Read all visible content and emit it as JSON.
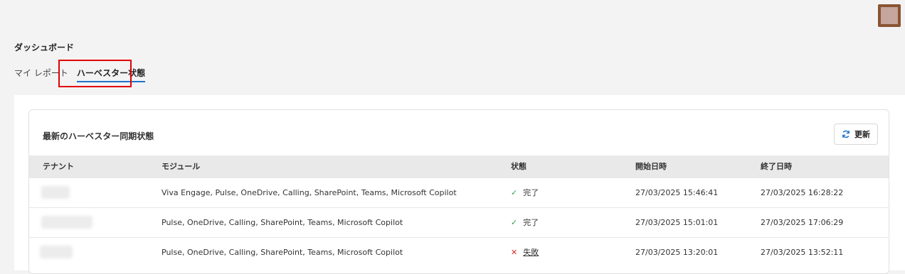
{
  "header": {
    "avatar_color": "#8a5433"
  },
  "page": {
    "title": "ダッシュボード"
  },
  "tabs": [
    {
      "label": "マイ レポート",
      "active": false
    },
    {
      "label": "ハーベスター状態",
      "active": true
    }
  ],
  "card": {
    "title": "最新のハーベスター同期状態",
    "refresh_label": "更新"
  },
  "table": {
    "columns": [
      "テナント",
      "モジュール",
      "状態",
      "開始日時",
      "終了日時"
    ],
    "rows": [
      {
        "tenant": "",
        "modules": "Viva Engage, Pulse, OneDrive, Calling, SharePoint, Teams, Microsoft Copilot",
        "status": "完了",
        "status_icon": "check-icon",
        "start": "27/03/2025 15:46:41",
        "end": "27/03/2025 16:28:22"
      },
      {
        "tenant": "",
        "modules": "Pulse, OneDrive, Calling, SharePoint, Teams, Microsoft Copilot",
        "status": "完了",
        "status_icon": "check-icon",
        "start": "27/03/2025 15:01:01",
        "end": "27/03/2025 17:06:29"
      },
      {
        "tenant": "",
        "modules": "Pulse, OneDrive, Calling, SharePoint, Teams, Microsoft Copilot",
        "status": "失敗",
        "status_icon": "x-icon",
        "start": "27/03/2025 13:20:01",
        "end": "27/03/2025 13:52:11"
      }
    ]
  },
  "colors": {
    "accent": "#1b73c9",
    "success": "#2e9c4e",
    "error": "#d92b2b",
    "highlight": "#e00000"
  }
}
